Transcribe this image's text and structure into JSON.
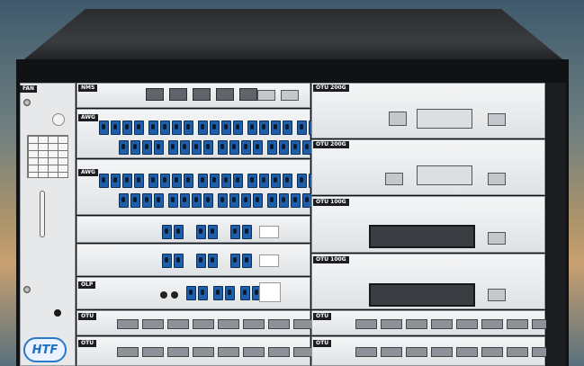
{
  "fan": {
    "label": "FAN"
  },
  "logo": {
    "text": "HTF"
  },
  "left_cards": [
    {
      "label": "NMS"
    },
    {
      "label": "AWG"
    },
    {
      "label": "AWG"
    },
    {
      "label": ""
    },
    {
      "label": ""
    },
    {
      "label": "OLP"
    },
    {
      "label": "OTU"
    },
    {
      "label": "OTU"
    }
  ],
  "right_cards": [
    {
      "label": "OTU 200G"
    },
    {
      "label": "OTU 200G"
    },
    {
      "label": "OTU 100G"
    },
    {
      "label": "OTU 100G"
    },
    {
      "label": "OTU"
    },
    {
      "label": "OTU"
    }
  ],
  "colors": {
    "port_blue": "#1f5ea8",
    "panel": "#e6e8ea",
    "chassis": "#111214"
  }
}
